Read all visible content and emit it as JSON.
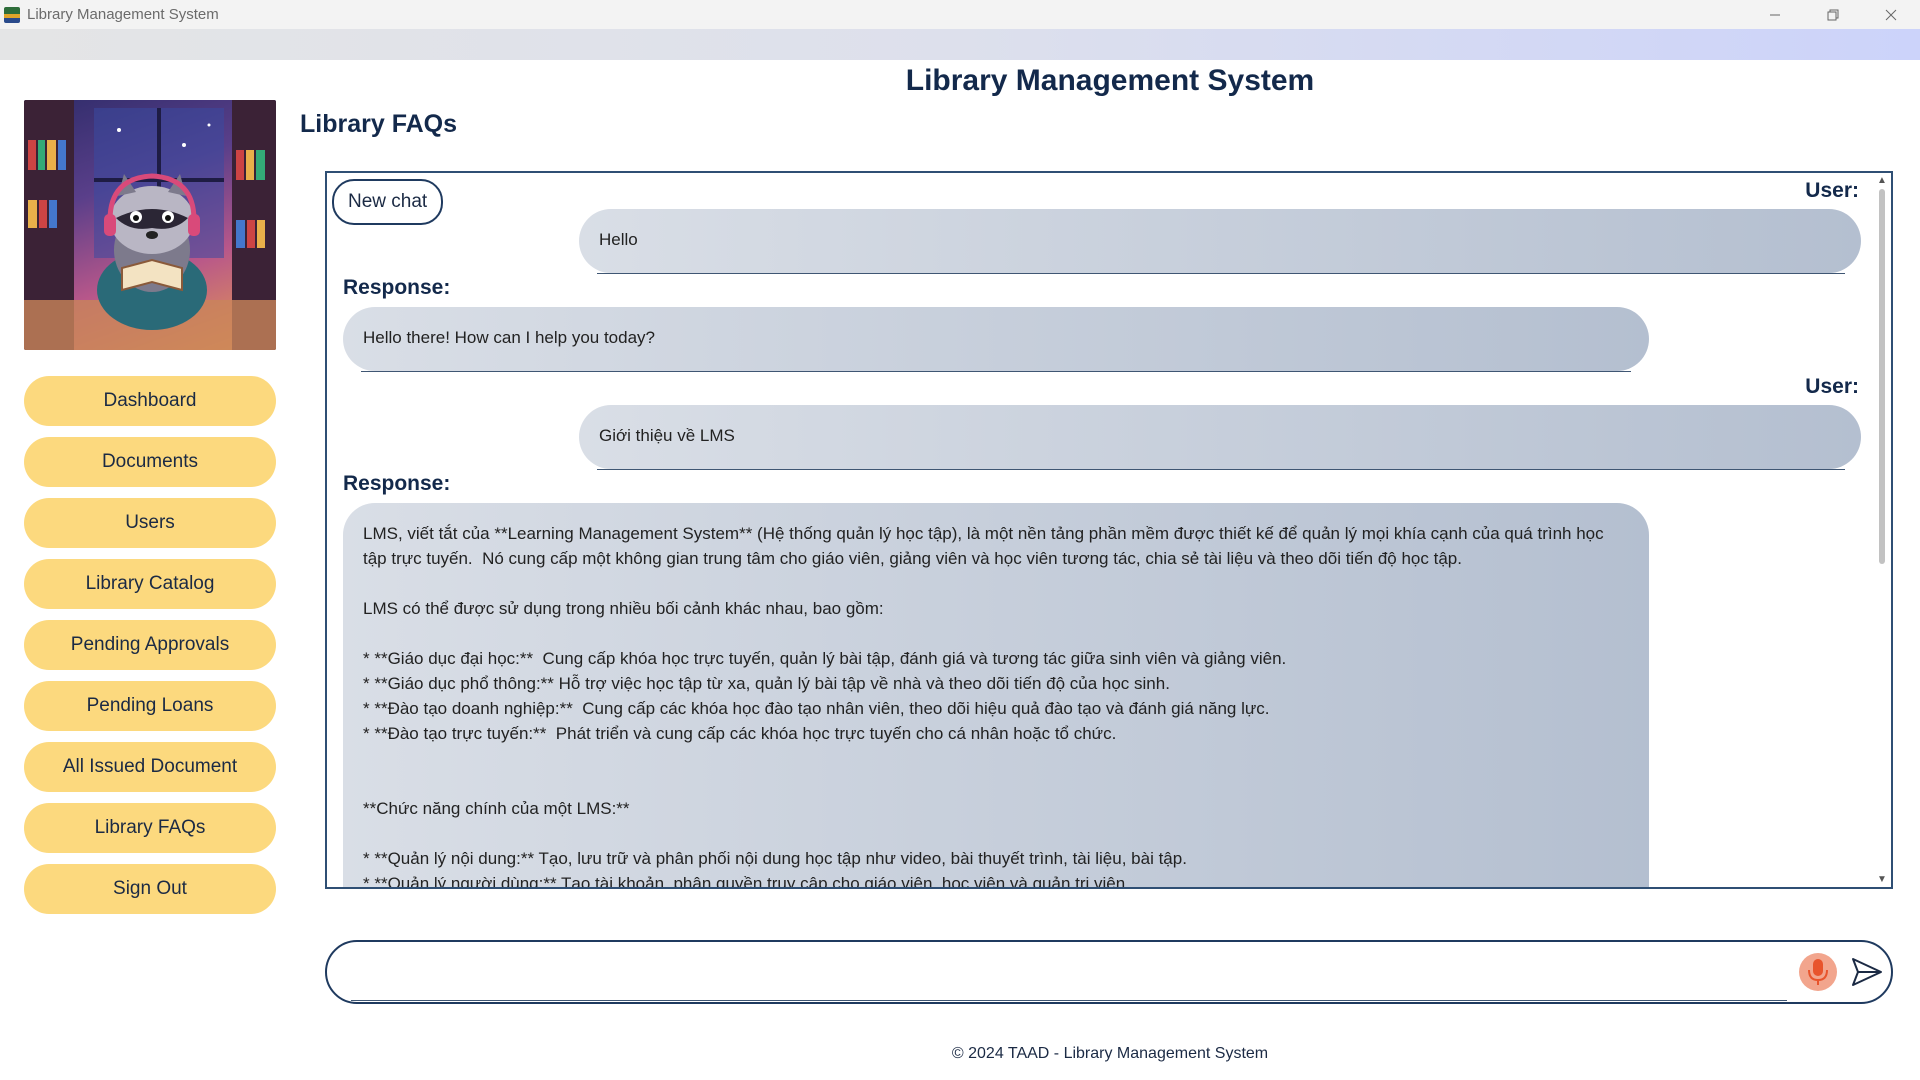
{
  "window": {
    "title": "Library Management System"
  },
  "header": {
    "app_title": "Library Management System",
    "page_heading": "Library FAQs"
  },
  "sidebar": {
    "items": [
      {
        "label": "Dashboard"
      },
      {
        "label": "Documents"
      },
      {
        "label": "Users"
      },
      {
        "label": "Library Catalog"
      },
      {
        "label": "Pending Approvals"
      },
      {
        "label": "Pending Loans"
      },
      {
        "label": "All Issued Document"
      },
      {
        "label": "Library FAQs"
      },
      {
        "label": "Sign Out"
      }
    ]
  },
  "chat": {
    "new_chat_label": "New chat",
    "user_role": "User:",
    "response_role": "Response:",
    "messages": [
      {
        "role": "user",
        "text": "Hello"
      },
      {
        "role": "response",
        "text": "Hello there! How can I help you today?"
      },
      {
        "role": "user",
        "text": "Giới thiệu về LMS"
      },
      {
        "role": "response",
        "text": "LMS, viết tắt của **Learning Management System** (Hệ thống quản lý học tập), là một nền tảng phần mềm được thiết kế để quản lý mọi khía cạnh của quá trình học tập trực tuyến.  Nó cung cấp một không gian trung tâm cho giáo viên, giảng viên và học viên tương tác, chia sẻ tài liệu và theo dõi tiến độ học tập.\n\nLMS có thể được sử dụng trong nhiều bối cảnh khác nhau, bao gồm:\n\n* **Giáo dục đại học:**  Cung cấp khóa học trực tuyến, quản lý bài tập, đánh giá và tương tác giữa sinh viên và giảng viên.\n* **Giáo dục phổ thông:** Hỗ trợ việc học tập từ xa, quản lý bài tập về nhà và theo dõi tiến độ của học sinh.\n* **Đào tạo doanh nghiệp:**  Cung cấp các khóa học đào tạo nhân viên, theo dõi hiệu quả đào tạo và đánh giá năng lực.\n* **Đào tạo trực tuyến:**  Phát triển và cung cấp các khóa học trực tuyến cho cá nhân hoặc tổ chức.\n\n\n**Chức năng chính của một LMS:**\n\n* **Quản lý nội dung:** Tạo, lưu trữ và phân phối nội dung học tập như video, bài thuyết trình, tài liệu, bài tập.\n* **Quản lý người dùng:** Tạo tài khoản, phân quyền truy cập cho giáo viên, học viên và quản trị viên."
      }
    ]
  },
  "input": {
    "value": "",
    "placeholder": ""
  },
  "footer": {
    "text": "© 2024 TAAD - Library Management System"
  },
  "colors": {
    "nav_button": "#fcd97e",
    "heading": "#13294b",
    "mic": "#e8542c"
  }
}
